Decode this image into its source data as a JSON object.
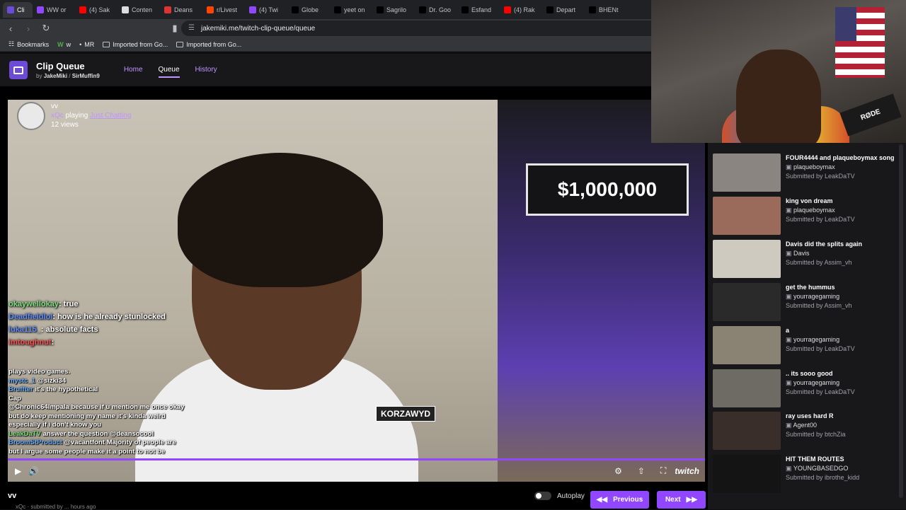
{
  "browser": {
    "tabs": [
      {
        "label": "Cli",
        "color": "#6c4bd6",
        "active": true
      },
      {
        "label": "WW or",
        "color": "#9147ff"
      },
      {
        "label": "(4) Sak",
        "color": "#ff0000"
      },
      {
        "label": "Conten",
        "color": "#dddddd"
      },
      {
        "label": "Deans",
        "color": "#d33"
      },
      {
        "label": "r/Livest",
        "color": "#ff4500"
      },
      {
        "label": "(4) Twi",
        "color": "#9147ff"
      },
      {
        "label": "Globe",
        "color": "#000000"
      },
      {
        "label": "yeet on",
        "color": "#000000"
      },
      {
        "label": "Sagrilo",
        "color": "#000000"
      },
      {
        "label": "Dr. Goo",
        "color": "#000000"
      },
      {
        "label": "Esfand",
        "color": "#000000"
      },
      {
        "label": "(4) Rak",
        "color": "#ff0000"
      },
      {
        "label": "Depart",
        "color": "#000000"
      },
      {
        "label": "BHENt",
        "color": "#000000"
      }
    ],
    "url": "jakemiki.me/twitch-clip-queue/queue",
    "bookmarks": [
      {
        "label": "Bookmarks",
        "icon": "apps-icon"
      },
      {
        "label": "w",
        "icon": "w-icon"
      },
      {
        "label": "MR",
        "icon": "mr-icon"
      },
      {
        "label": "Imported from Go...",
        "icon": "folder-icon"
      },
      {
        "label": "Imported from Go...",
        "icon": "folder-icon"
      }
    ]
  },
  "app": {
    "title": "Clip Queue",
    "by": "by",
    "author1": "JakeMiki",
    "author2": "SirMuffin9",
    "nav": [
      "Home",
      "Queue",
      "History"
    ],
    "active_nav": "Queue"
  },
  "clip": {
    "title": "vv",
    "streamer": "xQc",
    "playing": "playing",
    "game": "Just Chatting",
    "views": "12 views",
    "sign": "$1,000,000",
    "tag": "KORZAWYD",
    "submitted_by_prefix": "xQc · submitted by",
    "time_suffix": "hours ago",
    "chat": [
      {
        "user": "okaywellokay",
        "text": "true",
        "color": "green"
      },
      {
        "user": "Deadfieldlol",
        "text": "how is he already stunlocked",
        "color": "blue"
      },
      {
        "user": "luka115_",
        "text": "absolute facts",
        "color": "blue"
      },
      {
        "user": "imtoughnut",
        "text": "",
        "color": "red"
      }
    ],
    "stream_chat": [
      {
        "user": "",
        "text": "plays video games."
      },
      {
        "user": "mystc_1",
        "text": "@sizki34",
        "blue": true
      },
      {
        "user": "Bruffter",
        "text": "it's the hypothetical",
        "blue": true
      },
      {
        "user": "",
        "text": "Cap"
      },
      {
        "user": "",
        "text": "@Chronic64Impala because if u mention me once okay but do keep mentioning my name it's kinda weird especially if i don't know you"
      },
      {
        "user": "LeakDaTV",
        "text": "answer the question @deansocool"
      },
      {
        "user": "BroomStProduct",
        "text": "@vacantfont Majority of people are but I argue some people make it a point to not be",
        "blue": true
      }
    ]
  },
  "controls": {
    "autoplay_label": "Autoplay",
    "prev_label": "Previous",
    "next_label": "Next",
    "brand": "twitch"
  },
  "queue": [
    {
      "title": "FOUR4444 and plaqueboymax song",
      "channel": "plaqueboymax",
      "submitted": "Submitted by",
      "by": "LeakDaTV",
      "thumb": "#8a8580"
    },
    {
      "title": "king von dream",
      "channel": "plaqueboymax",
      "submitted": "Submitted by",
      "by": "LeakDaTV",
      "thumb": "#9a6a5a"
    },
    {
      "title": "Davis did the splits again",
      "channel": "Davis",
      "submitted": "Submitted by",
      "by": "Assim_vh",
      "thumb": "#cfcac0"
    },
    {
      "title": "get the hummus",
      "channel": "yourragegaming",
      "submitted": "Submitted by",
      "by": "Assim_vh",
      "thumb": "#2a2a2a"
    },
    {
      "title": "a",
      "channel": "yourragegaming",
      "submitted": "Submitted by",
      "by": "LeakDaTV",
      "thumb": "#8a8272"
    },
    {
      "title": ".. its sooo good",
      "channel": "yourragegaming",
      "submitted": "Submitted by",
      "by": "LeakDaTV",
      "thumb": "#6e6a64"
    },
    {
      "title": "ray uses hard R",
      "channel": "Agent00",
      "submitted": "Submitted by",
      "by": "btchZia",
      "thumb": "#3a2e2a"
    },
    {
      "title": "HIT THEM ROUTES",
      "channel": "YOUNGBASEDGO",
      "submitted": "Submitted by",
      "by": "ibrothe_kidd",
      "thumb": "#141414"
    }
  ],
  "webcam": {
    "mic_label": "RØDE"
  }
}
